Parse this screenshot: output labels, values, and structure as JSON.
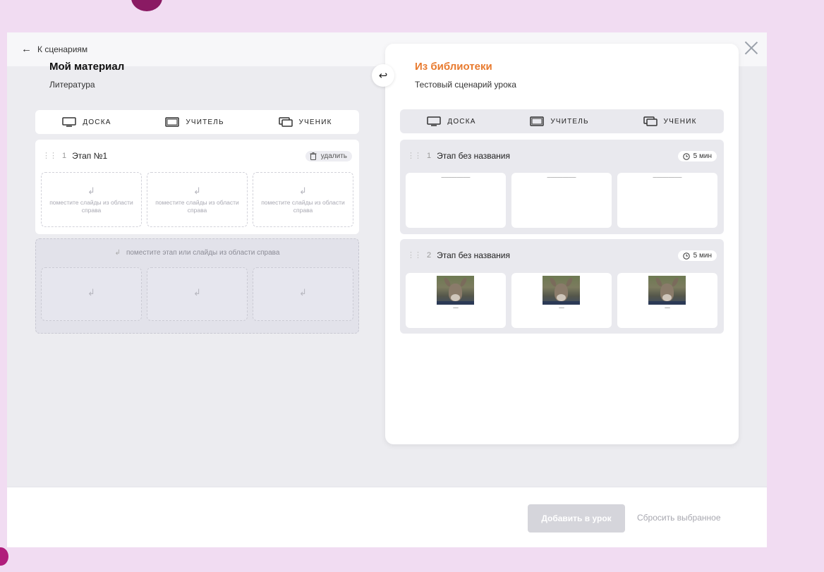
{
  "header": {
    "back_label": "К сценариям"
  },
  "left_panel": {
    "title": "Мой материал",
    "subtitle": "Литература",
    "tabs": [
      {
        "label": "ДОСКА",
        "icon": "board-icon"
      },
      {
        "label": "УЧИТЕЛЬ",
        "icon": "teacher-screen-icon"
      },
      {
        "label": "УЧЕНИК",
        "icon": "student-screens-icon"
      }
    ],
    "stage": {
      "number": "1",
      "title": "Этап №1",
      "delete_label": "удалить",
      "slots": [
        "поместите слайды из области справа",
        "поместите слайды из области справа",
        "поместите слайды из области справа"
      ]
    },
    "drop_zone_label": "поместите этап или слайды из области справа"
  },
  "right_panel": {
    "title": "Из библиотеки",
    "subtitle": "Тестовый сценарий урока",
    "tabs": [
      {
        "label": "ДОСКА",
        "icon": "board-icon"
      },
      {
        "label": "УЧИТЕЛЬ",
        "icon": "teacher-screen-icon"
      },
      {
        "label": "УЧЕНИК",
        "icon": "student-screens-icon"
      }
    ],
    "stages": [
      {
        "number": "1",
        "title": "Этап без названия",
        "time": "5 мин"
      },
      {
        "number": "2",
        "title": "Этап без названия",
        "time": "5 мин"
      }
    ]
  },
  "footer": {
    "add_label": "Добавить в урок",
    "reset_label": "Сбросить выбранное"
  },
  "colors": {
    "background": "#f1dcf2",
    "accent_orange": "#e87a2e",
    "disabled_button": "#d5d5db"
  }
}
